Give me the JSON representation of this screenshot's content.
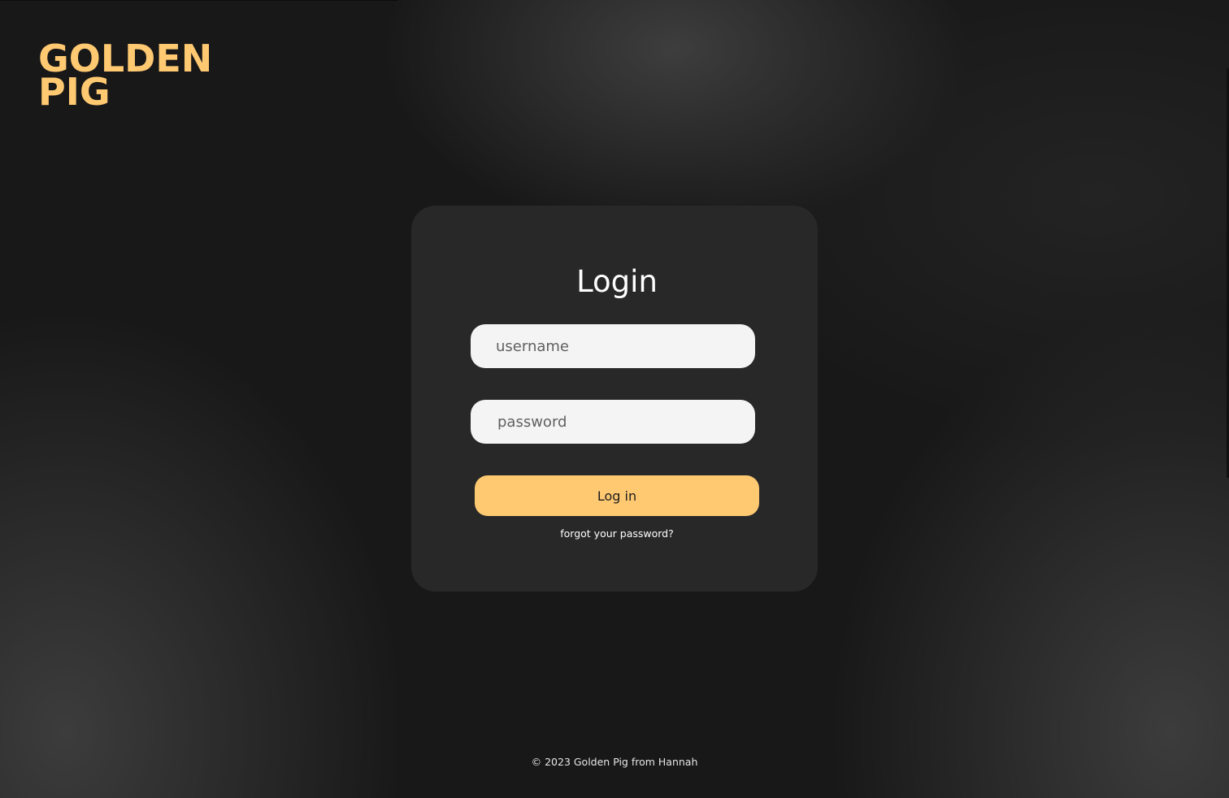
{
  "brand": {
    "logo_text": "GOLDEN\nPIG"
  },
  "login_form": {
    "title": "Login",
    "username_placeholder": "username",
    "password_placeholder": "password",
    "submit_label": "Log in",
    "forgot_password_label": "forgot your password?"
  },
  "footer": {
    "text": "© 2023 Golden Pig from Hannah"
  },
  "colors": {
    "accent": "#ffc972",
    "background": "#181818",
    "card": "#282828",
    "input_background": "#f4f4f4"
  }
}
